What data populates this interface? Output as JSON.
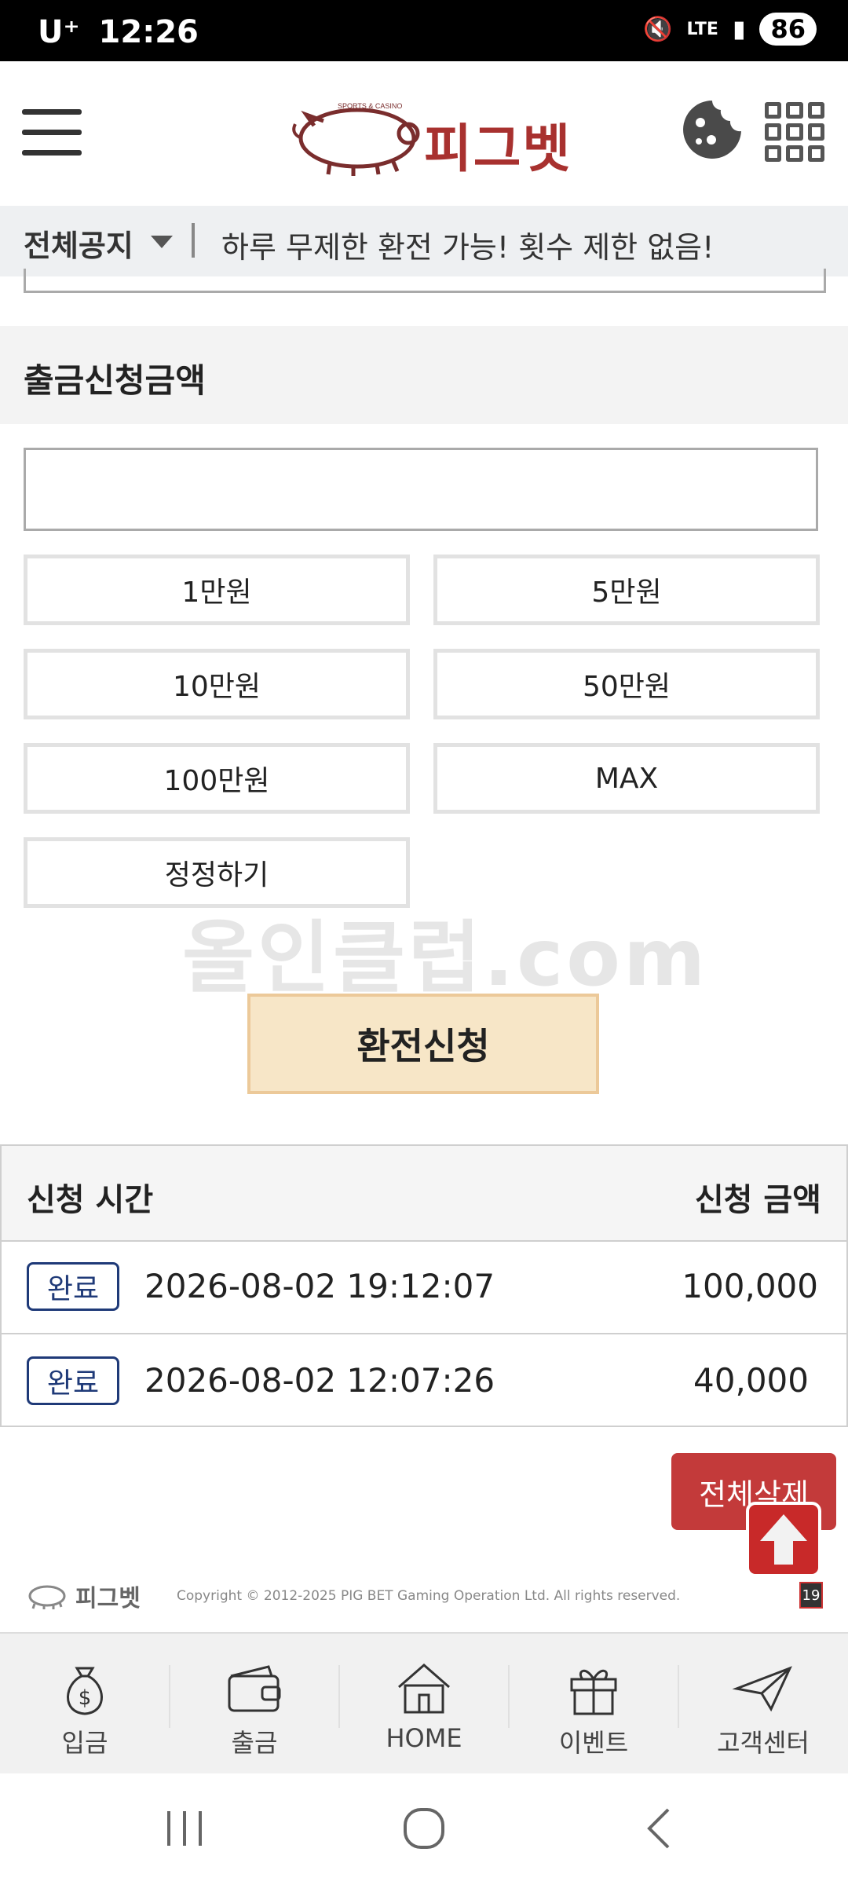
{
  "status_bar": {
    "carrier": "U⁺",
    "time": "12:26",
    "network": "LTE",
    "battery": "86"
  },
  "header": {
    "logo_text": "피그벳",
    "logo_tagline": "SPORTS & CASINO"
  },
  "notice": {
    "label": "전체공지",
    "message": "하루 무제한 환전 가능! 횟수 제한 없음!"
  },
  "form": {
    "section_title": "출금신청금액",
    "amount_value": "",
    "quick_buttons": [
      "1만원",
      "5만원",
      "10만원",
      "50만원",
      "100만원",
      "MAX"
    ],
    "reset_label": "정정하기",
    "submit_label": "환전신청"
  },
  "watermark": "올인클럽.com",
  "history": {
    "col_time": "신청 시간",
    "col_amount": "신청 금액",
    "rows": [
      {
        "status": "완료",
        "time": "2026-08-02 19:12:07",
        "amount": "100,000"
      },
      {
        "status": "완료",
        "time": "2026-08-02 12:07:26",
        "amount": "40,000"
      }
    ],
    "delete_all_label": "전체삭제"
  },
  "footer": {
    "logo_text": "피그벳",
    "copyright": "Copyright © 2012-2025 PIG BET Gaming Operation Ltd. All rights reserved.",
    "age_badge": "19"
  },
  "bottom_nav": [
    {
      "label": "입금",
      "icon": "money-bag-icon"
    },
    {
      "label": "출금",
      "icon": "wallet-icon"
    },
    {
      "label": "HOME",
      "icon": "home-icon"
    },
    {
      "label": "이벤트",
      "icon": "gift-icon"
    },
    {
      "label": "고객센터",
      "icon": "paper-plane-icon"
    }
  ],
  "colors": {
    "brand_red": "#c33a3a",
    "badge_blue": "#1f3a78",
    "submit_bg": "#f7e6c7"
  }
}
